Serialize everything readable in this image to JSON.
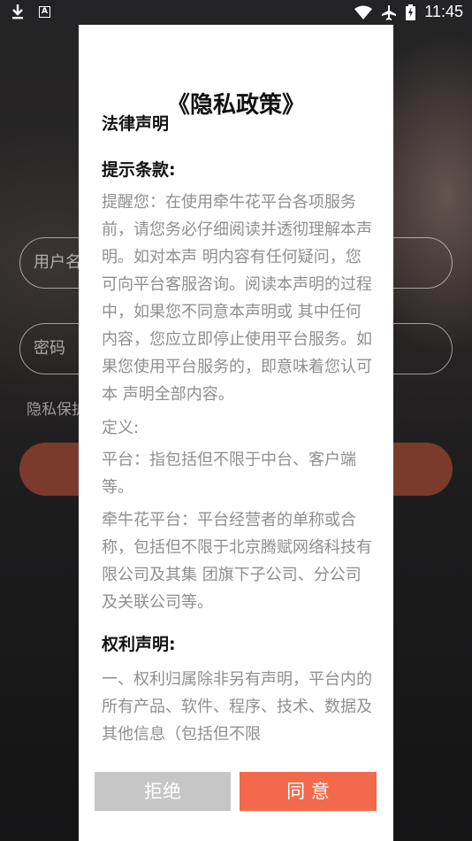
{
  "status_bar": {
    "time": "11:45",
    "a_glyph": "A"
  },
  "login": {
    "username_placeholder": "用户名",
    "password_placeholder": "密码",
    "privacy_hint": "隐私保护"
  },
  "dialog": {
    "title": "《隐私政策》",
    "section_legal": "法律声明",
    "section_tips": "提示条款:",
    "p_tips": "提醒您：在使用牵牛花平台各项服务前，请您务必仔细阅读并透彻理解本声明。如对本声 明内容有任何疑问，您可向平台客服咨询。阅读本声明的过程中，如果您不同意本声明或 其中任何内容，您应立即停止使用平台服务。如果您使用平台服务的，即意味着您认可本 声明全部内容。",
    "p_definition": "定义:",
    "p_platform": "平台：指包括但不限于中台、客户端等。",
    "p_qnh": "牵牛花平台：平台经营者的单称或合称，包括但不限于北京腾赋网络科技有限公司及其集 团旗下子公司、分公司及关联公司等。",
    "section_rights": "权利声明:",
    "p_rights": "一、权利归属除非另有声明，平台内的所有产品、软件、程序、技术、数据及其他信息（包括但不限",
    "reject_label": "拒绝",
    "agree_label": "同 意"
  }
}
